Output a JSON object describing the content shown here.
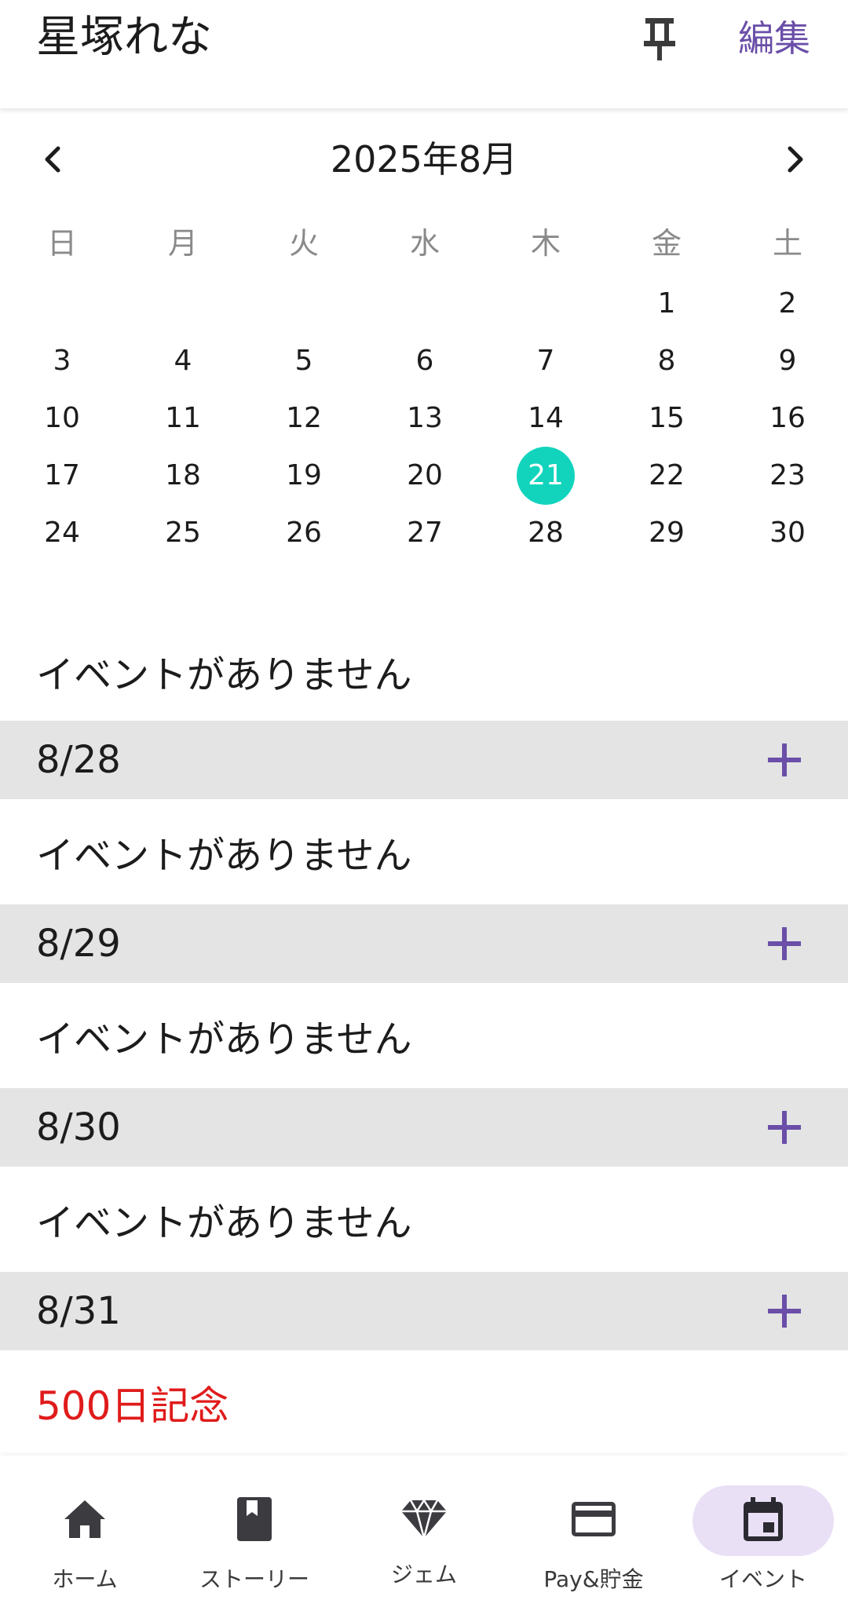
{
  "header": {
    "title": "星塚れな",
    "edit_label": "編集",
    "pin_icon": "pin-icon"
  },
  "calendar": {
    "month_label": "2025年8月",
    "weekdays": [
      "日",
      "月",
      "火",
      "水",
      "木",
      "金",
      "土"
    ],
    "days": [
      "",
      "",
      "",
      "",
      "",
      "1",
      "2",
      "3",
      "4",
      "5",
      "6",
      "7",
      "8",
      "9",
      "10",
      "11",
      "12",
      "13",
      "14",
      "15",
      "16",
      "17",
      "18",
      "19",
      "20",
      "21",
      "22",
      "23",
      "24",
      "25",
      "26",
      "27",
      "28",
      "29",
      "30"
    ],
    "selected_day": "21",
    "selected_color": "#12d4bd"
  },
  "events": {
    "first_empty": "イベントがありません",
    "dates": [
      {
        "date": "8/28",
        "event": "イベントがありません"
      },
      {
        "date": "8/29",
        "event": "イベントがありません"
      },
      {
        "date": "8/30",
        "event": "イベントがありません"
      },
      {
        "date": "8/31",
        "event": "500日記念"
      }
    ],
    "special_color": "#e01b1b",
    "accent_color": "#6a4ea8"
  },
  "nav": {
    "items": [
      {
        "label": "ホーム",
        "icon": "home-icon"
      },
      {
        "label": "ストーリー",
        "icon": "book-icon"
      },
      {
        "label": "ジェム",
        "icon": "gem-icon"
      },
      {
        "label": "Pay&貯金",
        "icon": "card-icon"
      },
      {
        "label": "イベント",
        "icon": "calendar-icon",
        "active": true
      }
    ]
  }
}
